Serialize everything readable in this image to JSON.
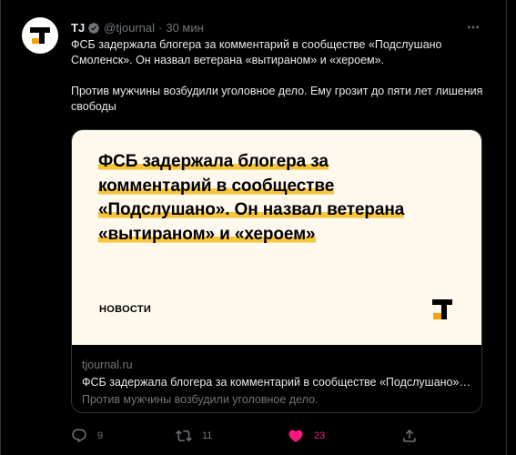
{
  "tweet": {
    "author_name": "TJ",
    "author_handle": "@tjournal",
    "separator": "·",
    "time_ago": "30 мин",
    "paragraphs": [
      "ФСБ задержала блогера за комментарий в сообществе «Подслушано Смоленск». Он назвал ветерана «вытираном» и «хероем».",
      "Против мужчины возбудили уголовное дело. Ему грозит до пяти лет лишения свободы"
    ]
  },
  "card": {
    "headline_lines": [
      "ФСБ задержала блогера за",
      "комментарий в сообществе",
      "«Подслушано». Он назвал ветерана",
      "«вытираном» и «хероем»"
    ],
    "section": "НОВОСТИ",
    "domain": "tjournal.ru",
    "title": "ФСБ задержала блогера за комментарий в сообществе «Подслушано» Он назвал ветерана «вытираном» и «хероем»",
    "description": "Против мужчины возбудили уголовное дело."
  },
  "actions": {
    "reply_count": "9",
    "retweet_count": "11",
    "like_count": "23"
  },
  "colors": {
    "background": "#000000",
    "text": "#e7e9ea",
    "secondary": "#71767b",
    "like": "#f91880",
    "card_bg": "#fff8ec",
    "highlight": "#f5c53a"
  },
  "icons": [
    "verified-icon",
    "more-icon",
    "reply-icon",
    "retweet-icon",
    "like-icon",
    "share-icon",
    "tj-logo"
  ]
}
